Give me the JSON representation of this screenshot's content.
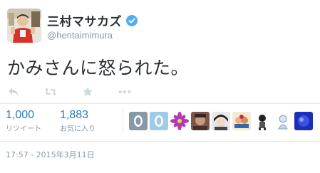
{
  "user": {
    "display_name": "三村マサカズ",
    "username": "@hentaimimura"
  },
  "tweet": {
    "text": "かみさんに怒られた。"
  },
  "actions": [
    "reply-icon",
    "retweet-icon",
    "favorite-icon",
    "more-icon"
  ],
  "stats": {
    "retweets": {
      "count": "1,000",
      "label": "リツイート"
    },
    "favorites": {
      "count": "1,883",
      "label": "お気に入り"
    }
  },
  "timestamp": "17:57 - 2015年3月11日",
  "colors": {
    "link_blue": "#2b7bb9",
    "muted": "#8899a6",
    "text": "#292f33",
    "verified": "#55acee"
  }
}
